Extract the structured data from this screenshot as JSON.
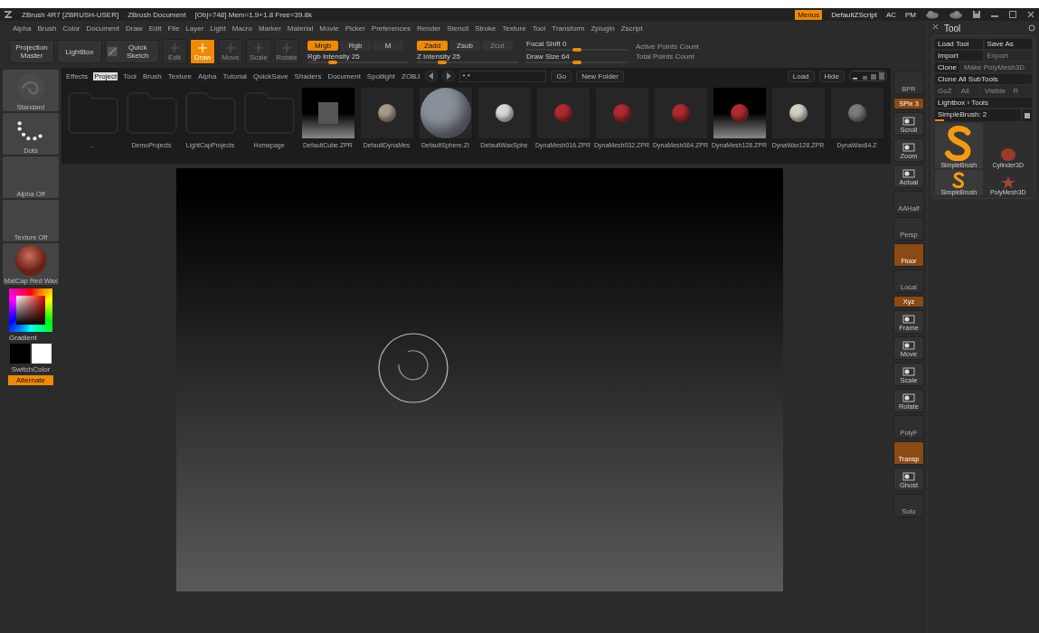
{
  "title_bar": {
    "texts": [
      "ZBrush 4R7 [ZBRUSH-USER]",
      "ZBrush Document",
      "[Obj=748] Mem=1.9+1.8 Free=39.8k"
    ],
    "menus_button": "Menus",
    "script": "DefaultZScript",
    "extras": [
      "AC",
      "PM"
    ]
  },
  "menu_bar": {
    "items": [
      "Alpha",
      "Brush",
      "Color",
      "Document",
      "Draw",
      "Edit",
      "File",
      "Layer",
      "Light",
      "Macro",
      "Marker",
      "Material",
      "Movie",
      "Picker",
      "Preferences",
      "Render",
      "Stencil",
      "Stroke",
      "Texture",
      "Tool",
      "Transform",
      "Zplugin",
      "Zscript"
    ]
  },
  "toolbar": {
    "projection_master": "Projection Master",
    "lightbox": "LightBox",
    "quick_sketch": "Quick Sketch",
    "modes": [
      {
        "label": "Edit",
        "selected": false,
        "disabled": true
      },
      {
        "label": "Draw",
        "selected": true,
        "disabled": false
      },
      {
        "label": "Move",
        "selected": false,
        "disabled": true
      },
      {
        "label": "Scale",
        "selected": false,
        "disabled": true
      },
      {
        "label": "Rotate",
        "selected": false,
        "disabled": true
      }
    ],
    "rgb": [
      {
        "label": "Mrgb",
        "selected": true
      },
      {
        "label": "Rgb",
        "selected": false
      },
      {
        "label": "M",
        "selected": false
      }
    ],
    "z": [
      {
        "label": "Zadd",
        "selected": true,
        "disabled": false
      },
      {
        "label": "Zsub",
        "selected": false,
        "disabled": false
      },
      {
        "label": "Zcut",
        "selected": false,
        "disabled": true
      }
    ],
    "sliders": [
      {
        "label": "Rgb Intensity 25",
        "level": 0.25
      },
      {
        "label": "Z Intensity 25",
        "level": 0.25
      },
      {
        "label": "Focal Shift 0",
        "level": 0.5
      },
      {
        "label": "Draw Size 64",
        "level": 0.5
      }
    ],
    "counts": [
      "Active Points Count",
      "Total Points Count"
    ]
  },
  "lightbox": {
    "tabs": [
      {
        "label": "Effects",
        "selected": false
      },
      {
        "label": "Project",
        "selected": true
      },
      {
        "label": "Tool",
        "selected": false
      },
      {
        "label": "Brush",
        "selected": false
      },
      {
        "label": "Texture",
        "selected": false
      },
      {
        "label": "Alpha",
        "selected": false
      },
      {
        "label": "Tutorial",
        "selected": false
      },
      {
        "label": "QuickSave",
        "selected": false
      },
      {
        "label": "Shaders",
        "selected": false
      },
      {
        "label": "Document",
        "selected": false
      },
      {
        "label": "Spotlight",
        "selected": false
      },
      {
        "label": "ZOBJ",
        "selected": false
      }
    ],
    "path": "*.*",
    "go": "Go",
    "new_folder": "New Folder",
    "load": "Load",
    "hide": "Hide",
    "items": [
      {
        "label": "..",
        "kind": "folder"
      },
      {
        "label": "DemoProjects",
        "kind": "folder"
      },
      {
        "label": "LightCapProjects",
        "kind": "folder"
      },
      {
        "label": "Homepage",
        "kind": "folder"
      },
      {
        "label": "DefaultCube.ZPR",
        "kind": "cube"
      },
      {
        "label": "DefaultDynaMes",
        "kind": "small-sphere",
        "color": "#a89a8c"
      },
      {
        "label": "DefaultSphere.ZI",
        "kind": "big-sphere",
        "color": "#8a909a"
      },
      {
        "label": "DefaultWaxSphe",
        "kind": "small-sphere",
        "color": "#d8d8d8"
      },
      {
        "label": "DynaMesh016.ZPR",
        "kind": "small-sphere",
        "color": "#b02a30"
      },
      {
        "label": "DynaMesh032.ZPR",
        "kind": "small-sphere",
        "color": "#b02a30"
      },
      {
        "label": "DynaMesh064.ZPR",
        "kind": "small-sphere",
        "color": "#b02a30"
      },
      {
        "label": "DynaMesh128.ZPR",
        "kind": "lit-sphere",
        "color": "#b02a30"
      },
      {
        "label": "DynaWax128.ZPR",
        "kind": "small-sphere",
        "color": "#d6d0c4"
      },
      {
        "label": "DynaWax64.Z",
        "kind": "small-sphere",
        "color": "#7a7c7e"
      }
    ]
  },
  "left_shelf": {
    "thumbs": [
      {
        "label": "Standard",
        "kind": "brush"
      },
      {
        "label": "Dots",
        "kind": "stroke"
      },
      {
        "label": "Alpha Off",
        "kind": "blank"
      },
      {
        "label": "Texture Off",
        "kind": "blank"
      },
      {
        "label": "MatCap Red Wax",
        "kind": "material"
      }
    ],
    "gradient": "Gradient",
    "switch_color": "SwitchColor",
    "alternate": "Alternate"
  },
  "right_shelf": {
    "buttons": [
      {
        "label": "BPR",
        "kind": "blank",
        "on": false
      },
      {
        "label": "SPix 3",
        "kind": "slider",
        "on": true
      },
      {
        "label": "Scroll",
        "kind": "icon",
        "on": false
      },
      {
        "label": "Zoom",
        "kind": "icon",
        "on": false
      },
      {
        "label": "Actual",
        "kind": "icon",
        "on": false
      },
      {
        "label": "AAHalf",
        "kind": "blank",
        "on": false
      },
      {
        "label": "Persp",
        "kind": "blank",
        "on": false
      },
      {
        "label": "Floor",
        "kind": "blank",
        "on": true
      },
      {
        "label": "Local",
        "kind": "blank",
        "on": false
      },
      {
        "label": "Xyz",
        "kind": "slider",
        "on": true
      },
      {
        "label": "Frame",
        "kind": "icon",
        "on": false
      },
      {
        "label": "Move",
        "kind": "icon",
        "on": false
      },
      {
        "label": "Scale",
        "kind": "icon",
        "on": false
      },
      {
        "label": "Rotate",
        "kind": "icon",
        "on": false
      },
      {
        "label": "PolyF",
        "kind": "blank",
        "on": false
      },
      {
        "label": "Transp",
        "kind": "blank",
        "on": true
      },
      {
        "label": "Ghost",
        "kind": "icon",
        "on": false
      },
      {
        "label": "Solo",
        "kind": "blank",
        "on": false
      }
    ]
  },
  "tool_palette": {
    "title": "Tool",
    "load_tool": "Load Tool",
    "save_as": "Save As",
    "import": "Import",
    "export": "Export",
    "clone": "Clone",
    "make_polymesh": "Make PolyMesh3D",
    "clone_all": "Clone All SubTools",
    "row": [
      "GoZ",
      "All",
      "Visible",
      "R"
    ],
    "lightbox_tools": "Lightbox › Tools",
    "current_tool": {
      "label": "SimpleBrush: 2",
      "level": 0.1
    },
    "tools": [
      {
        "label": "SimpleBrush",
        "kind": "big-s"
      },
      {
        "label": "SimpleBrush",
        "kind": "small-s"
      },
      {
        "label": "Cylinder3D",
        "kind": "cylinder"
      },
      {
        "label": "PolyMesh3D",
        "kind": "star"
      }
    ]
  }
}
